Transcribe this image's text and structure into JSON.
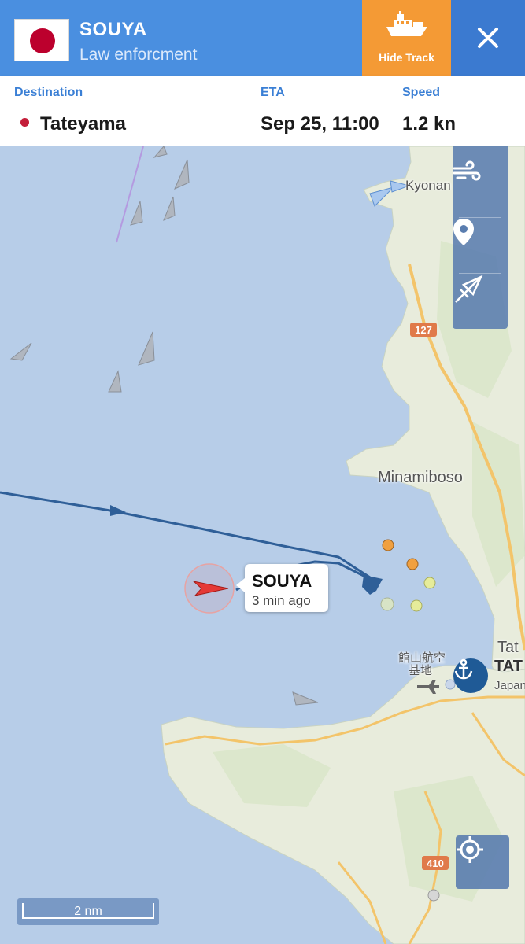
{
  "header": {
    "vessel_name": "SOUYA",
    "vessel_type": "Law enforcment",
    "flag": "japan-flag",
    "hide_track_label": "Hide Track",
    "colors": {
      "bar": "#4a8fe0",
      "hide_track": "#f49a35",
      "close": "#3b7ad0"
    }
  },
  "info": {
    "destination_label": "Destination",
    "destination_value": "Tateyama",
    "eta_label": "ETA",
    "eta_value": "Sep 25, 11:00",
    "speed_label": "Speed",
    "speed_value": "1.2 kn"
  },
  "map": {
    "labels": {
      "kyonan": "Kyonan",
      "minamiboso": "Minamiboso",
      "tate": "Tat",
      "tat_bold": "TAT",
      "japan": "Japan",
      "airbase_line1": "館山航空",
      "airbase_line2": "基地",
      "road_127": "127",
      "road_410": "410"
    },
    "vessel_callout": {
      "name": "SOUYA",
      "time": "3 min ago"
    },
    "scale_label": "2 nm",
    "tools": [
      "wind-icon",
      "map-pin-icon",
      "compass-measure-icon"
    ],
    "colors": {
      "sea": "#b7cde8",
      "land": "#eaeee0",
      "track": "#2f5f98",
      "vessel": "#e53935"
    }
  }
}
